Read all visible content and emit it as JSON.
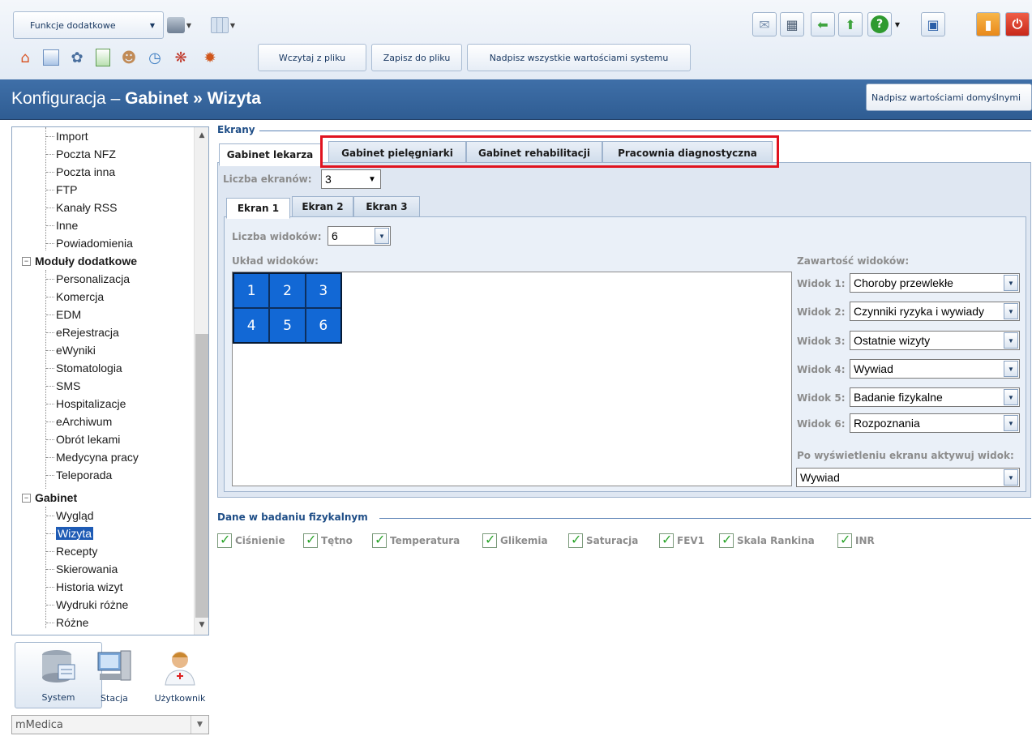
{
  "toolbar": {
    "functions_dropdown": "Funkcje dodatkowe",
    "load_file": "Wczytaj z pliku",
    "save_file": "Zapisz do pliku",
    "overwrite_all": "Nadpisz wszystkie wartościami systemu"
  },
  "header": {
    "title_prefix": "Konfiguracja –",
    "title_bold": "Gabinet » Wizyta",
    "defaults_button": "Nadpisz wartościami domyślnymi"
  },
  "tree": {
    "items_top": [
      "Import",
      "Poczta NFZ",
      "Poczta inna",
      "FTP",
      "Kanały RSS",
      "Inne",
      "Powiadomienia"
    ],
    "group1": "Moduły dodatkowe",
    "group1_items": [
      "Personalizacja",
      "Komercja",
      "EDM",
      "eRejestracja",
      "eWyniki",
      "Stomatologia",
      "SMS",
      "Hospitalizacje",
      "eArchiwum",
      "Obrót lekami",
      "Medycyna pracy",
      "Teleporada"
    ],
    "group2": "Gabinet",
    "group2_items": [
      "Wygląd",
      "Wizyta",
      "Recepty",
      "Skierowania",
      "Historia wizyt",
      "Wydruki różne",
      "Różne"
    ],
    "selected": "Wizyta"
  },
  "nav": {
    "system": "System",
    "station": "Stacja",
    "user": "Użytkownik",
    "database": "mMedica"
  },
  "screens": {
    "legend": "Ekrany",
    "tabs": [
      "Gabinet lekarza",
      "Gabinet pielęgniarki",
      "Gabinet rehabilitacji",
      "Pracownia diagnostyczna"
    ],
    "count_label": "Liczba ekranów:",
    "count_value": "3",
    "screen_tabs": [
      "Ekran 1",
      "Ekran 2",
      "Ekran 3"
    ],
    "views_count_label": "Liczba widoków:",
    "views_count_value": "6",
    "layout_label": "Układ widoków:",
    "grid_cells": [
      "1",
      "2",
      "3",
      "4",
      "5",
      "6"
    ],
    "contents_label": "Zawartość widoków:",
    "views": [
      {
        "label": "Widok 1:",
        "value": "Choroby przewlekłe"
      },
      {
        "label": "Widok 2:",
        "value": "Czynniki ryzyka i wywiady"
      },
      {
        "label": "Widok 3:",
        "value": "Ostatnie wizyty"
      },
      {
        "label": "Widok 4:",
        "value": "Wywiad"
      },
      {
        "label": "Widok 5:",
        "value": "Badanie fizykalne"
      },
      {
        "label": "Widok 6:",
        "value": "Rozpoznania"
      }
    ],
    "activate_label": "Po wyświetleniu ekranu aktywuj widok:",
    "activate_value": "Wywiad"
  },
  "physical_exam": {
    "legend": "Dane w badaniu fizykalnym",
    "items": [
      "Ciśnienie",
      "Tętno",
      "Temperatura",
      "Glikemia",
      "Saturacja",
      "FEV1",
      "Skala Rankina",
      "INR"
    ]
  },
  "colors": {
    "header_bg": "#3f6fa8",
    "highlight_border": "#e0131f",
    "grid_cell": "#1268d5",
    "selected_item": "#1e5bb5"
  }
}
